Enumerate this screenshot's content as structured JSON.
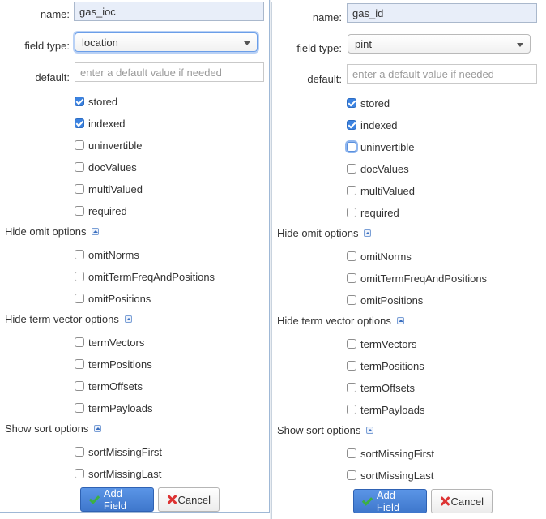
{
  "left": {
    "name_label": "name:",
    "name_value": "gas_ioc",
    "field_type_label": "field type:",
    "field_type_value": "location",
    "default_label": "default:",
    "default_placeholder": "enter a default value if needed",
    "checkboxes": [
      {
        "label": "stored",
        "checked": true
      },
      {
        "label": "indexed",
        "checked": true
      },
      {
        "label": "uninvertible",
        "checked": false
      },
      {
        "label": "docValues",
        "checked": false
      },
      {
        "label": "multiValued",
        "checked": false
      },
      {
        "label": "required",
        "checked": false
      }
    ],
    "omit_section": "Hide omit options",
    "omit_options": [
      {
        "label": "omitNorms",
        "checked": false
      },
      {
        "label": "omitTermFreqAndPositions",
        "checked": false
      },
      {
        "label": "omitPositions",
        "checked": false
      }
    ],
    "term_section": "Hide term vector options",
    "term_options": [
      {
        "label": "termVectors",
        "checked": false
      },
      {
        "label": "termPositions",
        "checked": false
      },
      {
        "label": "termOffsets",
        "checked": false
      },
      {
        "label": "termPayloads",
        "checked": false
      }
    ],
    "sort_section": "Show sort options",
    "sort_options": [
      {
        "label": "sortMissingFirst",
        "checked": false
      },
      {
        "label": "sortMissingLast",
        "checked": false
      }
    ],
    "add_button": "Add Field",
    "cancel_button": "Cancel"
  },
  "right": {
    "name_label": "name:",
    "name_value": "gas_id",
    "field_type_label": "field type:",
    "field_type_value": "pint",
    "default_label": "default:",
    "default_placeholder": "enter a default value if needed",
    "checkboxes": [
      {
        "label": "stored",
        "checked": true
      },
      {
        "label": "indexed",
        "checked": true
      },
      {
        "label": "uninvertible",
        "checked": false
      },
      {
        "label": "docValues",
        "checked": false
      },
      {
        "label": "multiValued",
        "checked": false
      },
      {
        "label": "required",
        "checked": false
      }
    ],
    "omit_section": "Hide omit options",
    "omit_options": [
      {
        "label": "omitNorms",
        "checked": false
      },
      {
        "label": "omitTermFreqAndPositions",
        "checked": false
      },
      {
        "label": "omitPositions",
        "checked": false
      }
    ],
    "term_section": "Hide term vector options",
    "term_options": [
      {
        "label": "termVectors",
        "checked": false
      },
      {
        "label": "termPositions",
        "checked": false
      },
      {
        "label": "termOffsets",
        "checked": false
      },
      {
        "label": "termPayloads",
        "checked": false
      }
    ],
    "sort_section": "Show sort options",
    "sort_options": [
      {
        "label": "sortMissingFirst",
        "checked": false
      },
      {
        "label": "sortMissingLast",
        "checked": false
      }
    ],
    "add_button": "Add Field",
    "cancel_button": "Cancel"
  },
  "icons": {
    "section_toggle": "collapse-arrow-icon",
    "add": "checkmark-icon",
    "cancel": "x-icon"
  },
  "colors": {
    "primary": "#3f77cc",
    "checked": "#3b82e0",
    "focus": "#6b9ee8"
  }
}
